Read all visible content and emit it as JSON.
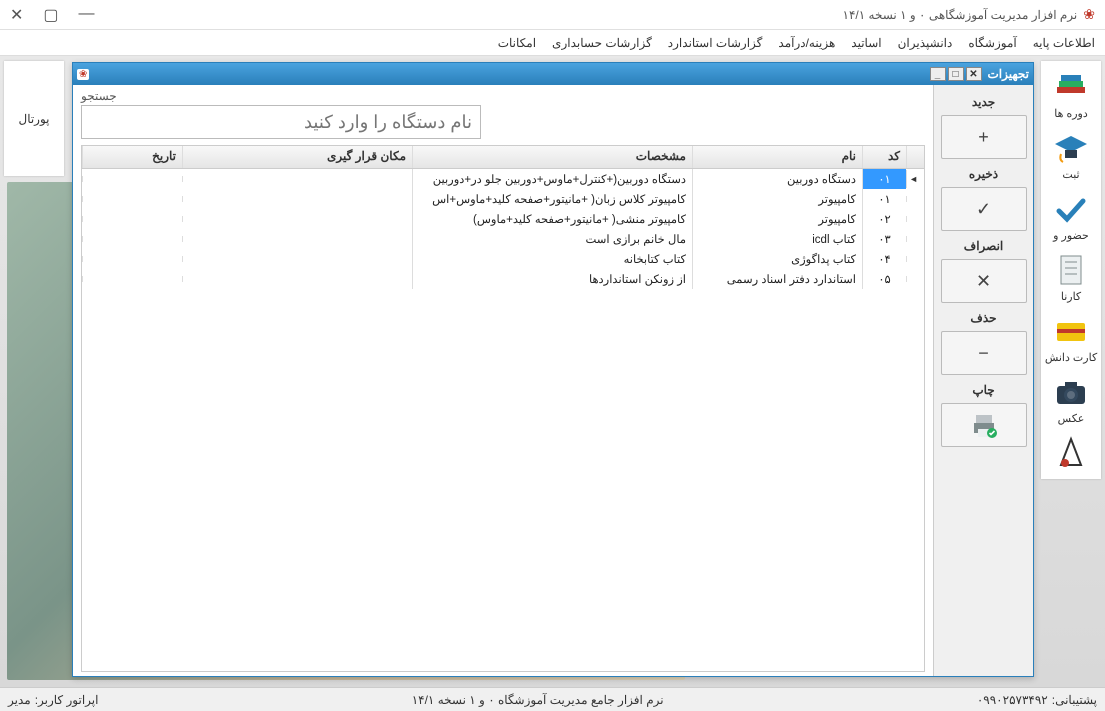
{
  "app": {
    "title": "نرم افزار مدیریت آموزشگاهی ۰ و ۱ نسخه ۱۴/۱"
  },
  "menu": {
    "items": [
      "اطلاعات پایه",
      "آموزشگاه",
      "دانشپذیران",
      "اساتید",
      "هزینه/درآمد",
      "گزارشات استاندارد",
      "گزارشات حسابداری",
      "امکانات"
    ]
  },
  "sidebar_right": {
    "items": [
      {
        "label": "دوره ها"
      },
      {
        "label": "ثبت"
      },
      {
        "label": "حضور و"
      },
      {
        "label": "کارنا"
      },
      {
        "label": "کارت دانش"
      },
      {
        "label": "عکس"
      }
    ]
  },
  "sidebar_left": {
    "label": "پورتال"
  },
  "subwin": {
    "title": "تجهیزات",
    "search_label": "جستجو",
    "search_placeholder": "نام دستگاه را وارد کنید",
    "actions": {
      "new": "جدید",
      "new_btn": "+",
      "save": "ذخیره",
      "save_btn": "✓",
      "cancel": "انصراف",
      "cancel_btn": "✕",
      "delete": "حذف",
      "delete_btn": "−",
      "print": "چاپ"
    },
    "columns": {
      "code": "کد",
      "name": "نام",
      "spec": "مشخصات",
      "loc": "مکان قرار گیری",
      "date": "تاریخ"
    },
    "rows": [
      {
        "code": "۰۱",
        "name": "دستگاه دوربین",
        "spec": "دستگاه دوربین(+کنترل+ماوس+دوربین جلو در+دوربین",
        "loc": "",
        "date": ""
      },
      {
        "code": "۰۱",
        "name": "کامپیوتر",
        "spec": "کامپیوتر کلاس زبان( +مانیتور+صفحه کلید+ماوس+اس",
        "loc": "",
        "date": ""
      },
      {
        "code": "۰۲",
        "name": "کامپیوتر",
        "spec": "کامپیوتر منشی( +مانیتور+صفحه کلید+ماوس)",
        "loc": "",
        "date": ""
      },
      {
        "code": "۰۳",
        "name": "کتاب icdl",
        "spec": "مال خانم برازی است",
        "loc": "",
        "date": ""
      },
      {
        "code": "۰۴",
        "name": "کتاب پداگوژی",
        "spec": "کتاب کتابخانه",
        "loc": "",
        "date": ""
      },
      {
        "code": "۰۵",
        "name": "استاندارد دفتر اسناد رسمی",
        "spec": "از زونکن استانداردها",
        "loc": "",
        "date": ""
      }
    ]
  },
  "status": {
    "support_label": "پشتیبانی:",
    "support_phone": "۰۹۹۰۲۵۷۳۴۹۲",
    "app_name": "نرم افزار جامع مدیریت آموزشگاه ۰ و ۱ نسخه ۱۴/۱",
    "operator_label": "اپراتور کاربر:",
    "operator_value": "مدیر"
  }
}
